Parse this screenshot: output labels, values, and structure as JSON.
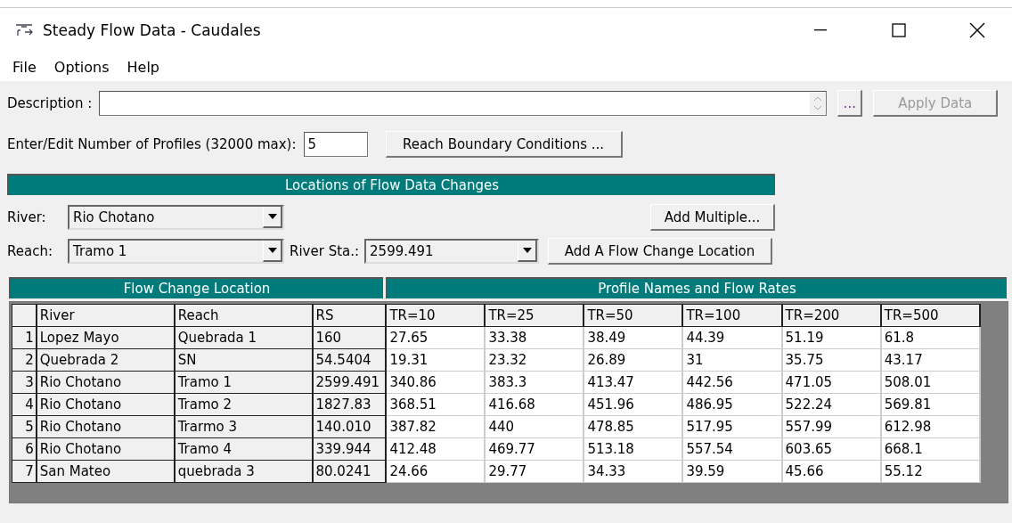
{
  "window": {
    "title": "Steady Flow Data - Caudales"
  },
  "menu": [
    "File",
    "Options",
    "Help"
  ],
  "description": {
    "label": "Description :",
    "browse_label": "..."
  },
  "apply_button": {
    "label": "Apply Data",
    "disabled": true
  },
  "profiles": {
    "label": "Enter/Edit Number of Profiles (32000 max):",
    "value": "5"
  },
  "boundary_button": "Reach Boundary Conditions ...",
  "locations": {
    "title": "Locations of Flow Data Changes",
    "river": {
      "label": "River:",
      "value": "Rio Chotano"
    },
    "reach": {
      "label": "Reach:",
      "value": "Tramo 1"
    },
    "station": {
      "label": "River Sta.:",
      "value": "2599.491"
    },
    "add_multiple": "Add Multiple...",
    "add_location": "Add A Flow Change Location"
  },
  "table": {
    "left_title": "Flow Change Location",
    "right_title": "Profile Names and Flow Rates",
    "columns": [
      "River",
      "Reach",
      "RS"
    ],
    "profiles": [
      "TR=10",
      "TR=25",
      "TR=50",
      "TR=100",
      "TR=200",
      "TR=500"
    ],
    "rows": [
      {
        "number": "1",
        "river": "Lopez Mayo",
        "reach": "Quebrada 1",
        "rs": "160",
        "flows": [
          "27.65",
          "33.38",
          "38.49",
          "44.39",
          "51.19",
          "61.8"
        ]
      },
      {
        "number": "2",
        "river": "Quebrada 2",
        "reach": "SN",
        "rs": "54.5404",
        "flows": [
          "19.31",
          "23.32",
          "26.89",
          "31",
          "35.75",
          "43.17"
        ]
      },
      {
        "number": "3",
        "river": "Rio Chotano",
        "reach": "Tramo 1",
        "rs": "2599.491",
        "flows": [
          "340.86",
          "383.3",
          "413.47",
          "442.56",
          "471.05",
          "508.01"
        ]
      },
      {
        "number": "4",
        "river": "Rio Chotano",
        "reach": "Tramo 2",
        "rs": "1827.83",
        "flows": [
          "368.51",
          "416.68",
          "451.96",
          "486.95",
          "522.24",
          "569.81"
        ]
      },
      {
        "number": "5",
        "river": "Rio Chotano",
        "reach": "Trarmo 3",
        "rs": "140.010",
        "flows": [
          "387.82",
          "440",
          "478.85",
          "517.95",
          "557.99",
          "612.98"
        ]
      },
      {
        "number": "6",
        "river": "Rio Chotano",
        "reach": "Tramo 4",
        "rs": "339.944",
        "flows": [
          "412.48",
          "469.77",
          "513.18",
          "557.54",
          "603.65",
          "668.1"
        ]
      },
      {
        "number": "7",
        "river": "San Mateo",
        "reach": "quebrada 3",
        "rs": "80.0241",
        "flows": [
          "24.66",
          "29.77",
          "34.33",
          "39.59",
          "45.66",
          "55.12"
        ]
      }
    ]
  }
}
